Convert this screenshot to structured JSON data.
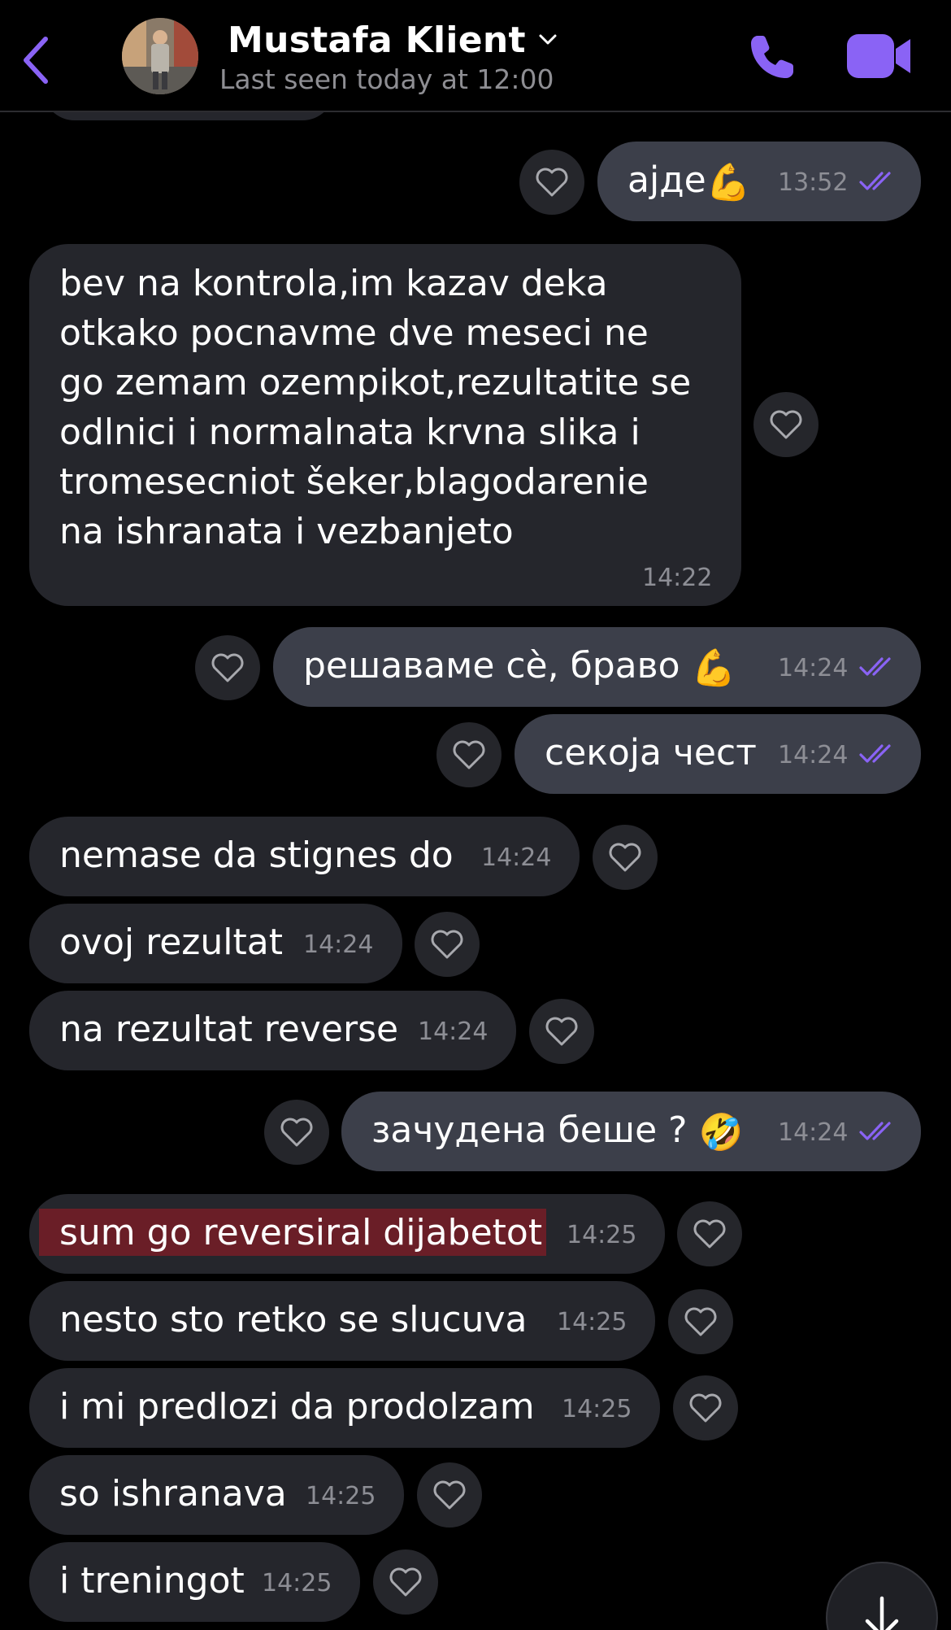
{
  "header": {
    "contact_name": "Mustafa Klient",
    "last_seen": "Last seen today at 12:00"
  },
  "colors": {
    "accent": "#8a63f5",
    "incoming_bubble": "#25262c",
    "outgoing_bubble": "#3c3f4a",
    "highlight": "#6a1e27",
    "background": "#000000"
  },
  "icons": {
    "back": "chevron-left-icon",
    "call": "phone-icon",
    "video": "video-camera-icon",
    "like": "heart-outline-icon",
    "read": "double-check-icon",
    "scroll": "arrow-down-icon"
  },
  "messages": [
    {
      "dir": "out",
      "text": "ајде",
      "emoji": "💪",
      "time": "13:52",
      "read": true
    },
    {
      "dir": "in",
      "lines": [
        "bev na kontrola,im kazav deka",
        "otkako pocnavme dve meseci ne",
        "go zemam ozempikot,rezultatite se",
        "odlnici i normalnata krvna slika i",
        "tromesecniot šeker,blagodarenie",
        "na ishranata i vezbanjeto"
      ],
      "time": "14:22"
    },
    {
      "dir": "out",
      "text": "решаваме сè, браво",
      "emoji": "💪",
      "time": "14:24",
      "read": true
    },
    {
      "dir": "out",
      "text": "секоја чест",
      "time": "14:24",
      "read": true
    },
    {
      "dir": "in",
      "text": "nemase da stignes do",
      "time": "14:24"
    },
    {
      "dir": "in",
      "text": "ovoj rezultat",
      "time": "14:24"
    },
    {
      "dir": "in",
      "text": "na rezultat reverse",
      "time": "14:24"
    },
    {
      "dir": "out",
      "text": "зачудена беше ?",
      "emoji": "🤣",
      "time": "14:24",
      "read": true
    },
    {
      "dir": "in",
      "text": "sum go reversiral dijabetot",
      "time": "14:25",
      "highlighted": true
    },
    {
      "dir": "in",
      "text": "nesto sto retko se slucuva",
      "time": "14:25"
    },
    {
      "dir": "in",
      "text": "i mi predlozi da prodolzam",
      "time": "14:25"
    },
    {
      "dir": "in",
      "text": "so ishranava",
      "time": "14:25"
    },
    {
      "dir": "in",
      "text": "i treningot",
      "time": "14:25"
    }
  ]
}
